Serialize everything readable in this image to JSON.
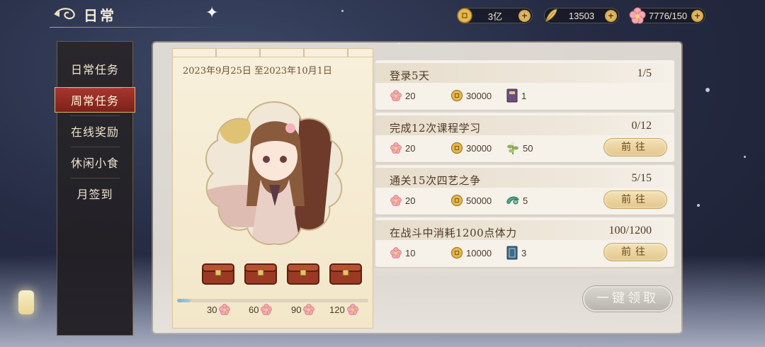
{
  "header": {
    "title": "日常",
    "currencies": [
      {
        "icon": "coin-icon",
        "value": "3亿"
      },
      {
        "icon": "feather-icon",
        "value": "13503"
      },
      {
        "icon": "blossom-icon",
        "value": "7776/150"
      }
    ],
    "add_label": "+"
  },
  "sidebar": {
    "items": [
      {
        "label": "日常任务",
        "active": false
      },
      {
        "label": "周常任务",
        "active": true
      },
      {
        "label": "在线奖励",
        "active": false
      },
      {
        "label": "休闲小食",
        "active": false
      },
      {
        "label": "月签到",
        "active": false
      }
    ]
  },
  "showcase": {
    "date_range": "2023年9月25日 至2023年10月1日",
    "progress_fraction": 0.07,
    "milestones": [
      "30",
      "60",
      "90",
      "120"
    ]
  },
  "tasks": [
    {
      "title": "登录5天",
      "progress": "1/5",
      "rewards": [
        {
          "icon": "blossom-icon",
          "value": "20"
        },
        {
          "icon": "coin-icon",
          "value": "30000"
        },
        {
          "icon": "book-icon",
          "value": "1"
        }
      ],
      "button": null
    },
    {
      "title": "完成12次课程学习",
      "progress": "0/12",
      "rewards": [
        {
          "icon": "blossom-icon",
          "value": "20"
        },
        {
          "icon": "coin-icon",
          "value": "30000"
        },
        {
          "icon": "herb-icon",
          "value": "50"
        }
      ],
      "button": "前往"
    },
    {
      "title": "通关15次四艺之争",
      "progress": "5/15",
      "rewards": [
        {
          "icon": "blossom-icon",
          "value": "20"
        },
        {
          "icon": "coin-icon",
          "value": "50000"
        },
        {
          "icon": "jade-icon",
          "value": "5"
        }
      ],
      "button": "前往"
    },
    {
      "title": "在战斗中消耗1200点体力",
      "progress": "100/1200",
      "rewards": [
        {
          "icon": "blossom-icon",
          "value": "10"
        },
        {
          "icon": "coin-icon",
          "value": "10000"
        },
        {
          "icon": "scroll-book-icon",
          "value": "3"
        }
      ],
      "button": "前往"
    }
  ],
  "claim_all_label": "一键领取",
  "colors": {
    "accent_red": "#a8362e",
    "gold": "#e2c68b",
    "panel": "#f6f2ea",
    "progress_blue": "#7fb3cf"
  }
}
